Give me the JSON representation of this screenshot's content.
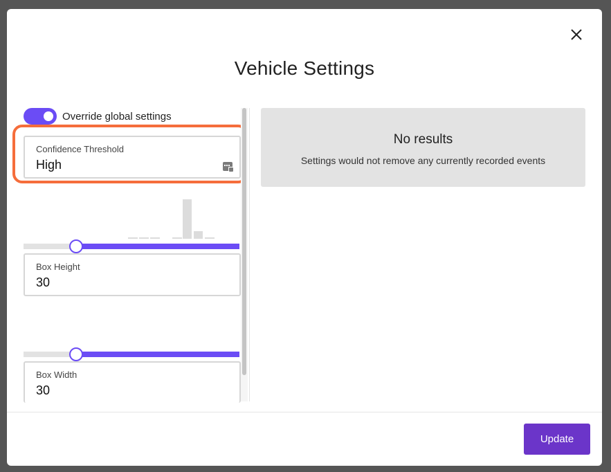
{
  "dialog": {
    "title": "Vehicle Settings",
    "close_icon": "close-icon"
  },
  "override": {
    "label": "Override global settings",
    "enabled": true
  },
  "confidence": {
    "label": "Confidence Threshold",
    "value": "High",
    "icon": "calendar-icon"
  },
  "box_height": {
    "label": "Box Height",
    "value": "30",
    "slider_level": 0.24
  },
  "box_width": {
    "label": "Box Width",
    "value": "30",
    "slider_level": 0.24
  },
  "results": {
    "title": "No results",
    "subtitle": "Settings would not remove any currently recorded events"
  },
  "footer": {
    "update_label": "Update"
  },
  "colors": {
    "accent": "#6b4cf5",
    "button": "#6b35c9",
    "highlight": "#f56d3b"
  }
}
